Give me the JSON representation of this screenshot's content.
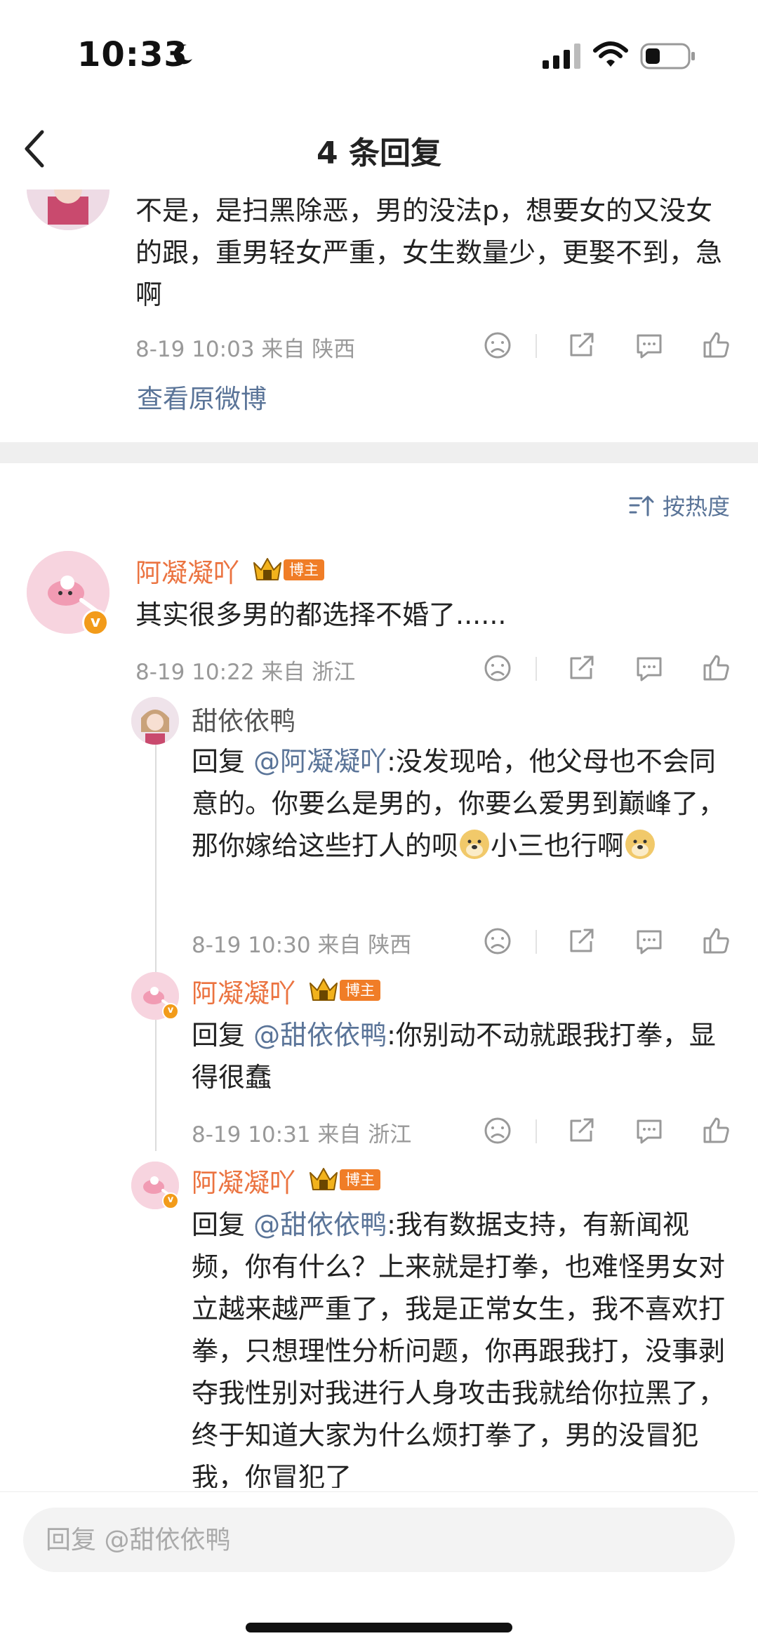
{
  "status": {
    "time": "10:33"
  },
  "nav": {
    "title": "4 条回复"
  },
  "original": {
    "text": "不是，是扫黑除恶，男的没法p，想要女的又没女的跟，重男轻女严重，女生数量少，更娶不到，急啊",
    "meta": "8-19 10:03  来自 陕西",
    "view_original": "查看原微博"
  },
  "sort": {
    "label": "按热度"
  },
  "comments": [
    {
      "user": "阿凝凝吖",
      "badge": "博主",
      "text": "其实很多男的都选择不婚了......",
      "meta": "8-19 10:22  来自 浙江"
    },
    {
      "user": "甜依依鸭",
      "reply_prefix": "回复 ",
      "mention": "@阿凝凝吖",
      "text_part1": ":没发现哈，他父母也不会同意的。你要么是男的，你要么爱男到巅峰了，那你嫁给这些打人的呗",
      "text_part2": "小三也行啊",
      "meta": "8-19 10:30  来自 陕西"
    },
    {
      "user": "阿凝凝吖",
      "badge": "博主",
      "reply_prefix": "回复 ",
      "mention": "@甜依依鸭",
      "text": ":你别动不动就跟我打拳，显得很蠢",
      "meta": "8-19 10:31  来自 浙江"
    },
    {
      "user": "阿凝凝吖",
      "badge": "博主",
      "reply_prefix": "回复 ",
      "mention": "@甜依依鸭",
      "text": ":我有数据支持，有新闻视频，你有什么？上来就是打拳，也难怪男女对立越来越严重了，我是正常女生，我不喜欢打拳，只想理性分析问题，你再跟我打，没事剥夺我性别对我进行人身攻击我就给你拉黑了，终于知道大家为什么烦打拳了，男的没冒犯我，你冒犯了"
    }
  ],
  "reply_bar": {
    "placeholder": "回复 @甜依依鸭"
  },
  "colors": {
    "accent_link": "#5a7498",
    "username_orange": "#eb7340",
    "badge_orange": "#f07d27"
  }
}
